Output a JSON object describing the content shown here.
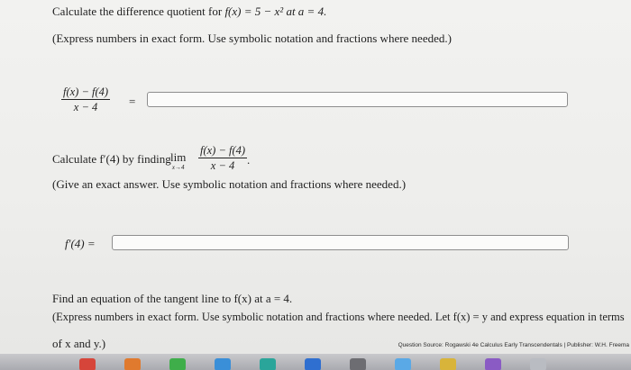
{
  "q1": {
    "prompt_text": "Calculate the difference quotient for",
    "f_def": "f(x) = 5 − x² at a = 4.",
    "instruction": "(Express numbers in exact form. Use symbolic notation and fractions where needed.)",
    "numerator": "f(x) − f(4)",
    "denominator": "x − 4",
    "equals": "="
  },
  "q2": {
    "prompt_text": "Calculate f′(4) by finding",
    "lim_word": "lim",
    "lim_sub": "x→4",
    "numerator": "f(x) − f(4)",
    "denominator": "x − 4",
    "period": ".",
    "instruction": "(Give an exact answer. Use symbolic notation and fractions where needed.)",
    "answer_label": "f′(4) ="
  },
  "q3": {
    "prompt_text": "Find an equation of the tangent line to f(x) at a = 4.",
    "instruction_line1": "(Express numbers in exact form. Use symbolic notation and fractions where needed. Let f(x) = y and express equation in terms",
    "instruction_line2": "of x and y.)"
  },
  "footer": {
    "source": "Question Source: Rogawski 4e Calculus Early Transcendentals  |  Publisher: W.H. Freema"
  },
  "dock": {
    "icons": [
      {
        "name": "app-icon-red",
        "color": "#d6453a"
      },
      {
        "name": "app-icon-orange",
        "color": "#e07a2e"
      },
      {
        "name": "app-icon-green",
        "color": "#3fae4a"
      },
      {
        "name": "app-icon-safari",
        "color": "#3a8fd8"
      },
      {
        "name": "app-icon-teal",
        "color": "#2aa59a"
      },
      {
        "name": "app-icon-blue",
        "color": "#2f6fd0"
      },
      {
        "name": "app-icon-gray",
        "color": "#6d6d72"
      },
      {
        "name": "app-icon-lightblue",
        "color": "#5aa9e6"
      },
      {
        "name": "app-icon-yellow",
        "color": "#d8b43a"
      },
      {
        "name": "app-icon-purple",
        "color": "#8a5bc4"
      },
      {
        "name": "app-icon-silver",
        "color": "#b9bcc2"
      }
    ]
  }
}
